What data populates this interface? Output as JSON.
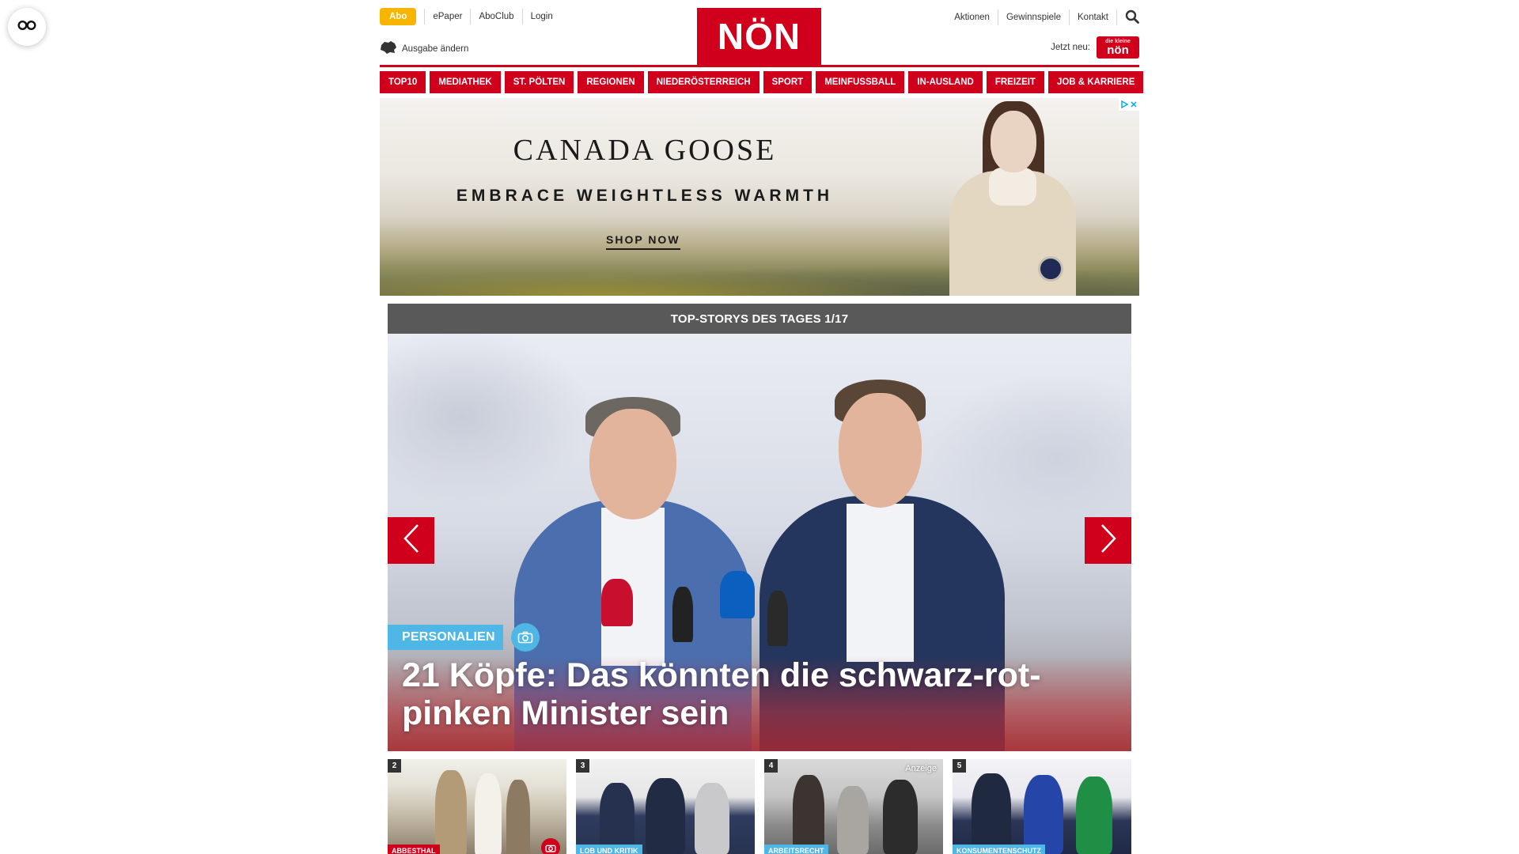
{
  "a11y": {
    "icon": "accessibility-glasses-icon"
  },
  "header": {
    "abo": "Abo",
    "top_links": [
      "ePaper",
      "AboClub",
      "Login"
    ],
    "edition": "Ausgabe ändern",
    "logo": "NÖN",
    "right_links": [
      "Aktionen",
      "Gewinnspiele",
      "Kontakt"
    ],
    "jetzt_neu": "Jetzt neu:",
    "kleine_badge": {
      "small": "die kleine",
      "big": "nön"
    }
  },
  "nav": {
    "items": [
      "TOP10",
      "MEDIATHEK",
      "ST. PÖLTEN",
      "REGIONEN",
      "NIEDERÖSTERREICH",
      "SPORT",
      "MEINFUSSBALL",
      "IN-AUSLAND",
      "FREIZEIT",
      "JOB & KARRIERE"
    ]
  },
  "ad": {
    "brand": "CANADA GOOSE",
    "tagline": "EMBRACE WEIGHTLESS WARMTH",
    "cta": "SHOP NOW"
  },
  "stories": {
    "heading": "TOP-STORYS DES TAGES 1/17",
    "hero": {
      "category": "PERSONALIEN",
      "title": "21 Köpfe: Das könnten die schwarz-rot-pinken Minister sein"
    },
    "thumbs": [
      {
        "num": "2",
        "category": "ABBESTHAL",
        "ad": ""
      },
      {
        "num": "3",
        "category": "LOB UND KRITIK",
        "ad": ""
      },
      {
        "num": "4",
        "category": "ARBEITSRECHT",
        "ad": "Anzeige"
      },
      {
        "num": "5",
        "category": "KONSUMENTENSCHUTZ",
        "ad": ""
      }
    ]
  },
  "colors": {
    "brand_red": "#d0001c",
    "abo_yellow": "#f7b500",
    "category_blue": "#4fb7e6",
    "header_gray": "#595959"
  }
}
